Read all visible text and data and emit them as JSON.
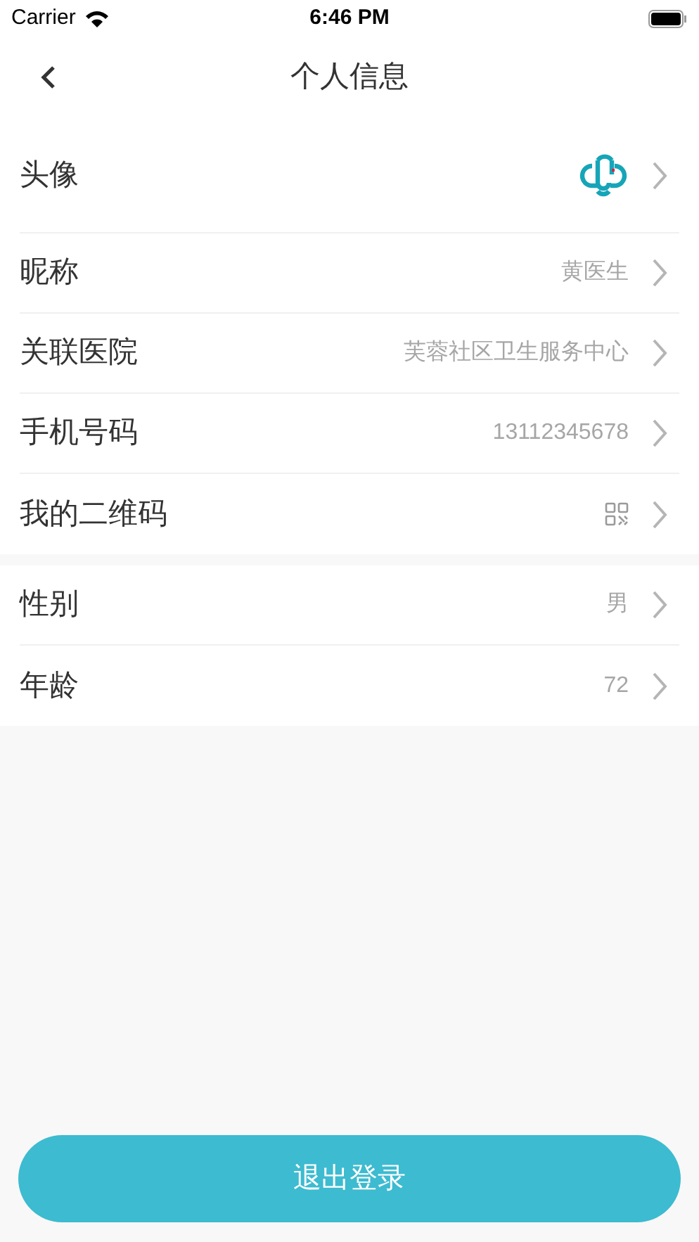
{
  "status_bar": {
    "carrier": "Carrier",
    "time": "6:46 PM"
  },
  "nav": {
    "title": "个人信息"
  },
  "sections": [
    {
      "rows": [
        {
          "kind": "avatar",
          "label": "头像"
        },
        {
          "kind": "text",
          "label": "昵称",
          "value": "黄医生"
        },
        {
          "kind": "text",
          "label": "关联医院",
          "value": "芙蓉社区卫生服务中心"
        },
        {
          "kind": "text",
          "label": "手机号码",
          "value": "13112345678"
        },
        {
          "kind": "qr",
          "label": "我的二维码"
        }
      ]
    },
    {
      "rows": [
        {
          "kind": "text",
          "label": "性别",
          "value": "男"
        },
        {
          "kind": "text",
          "label": "年龄",
          "value": "72"
        }
      ]
    }
  ],
  "logout_button": "退出登录"
}
